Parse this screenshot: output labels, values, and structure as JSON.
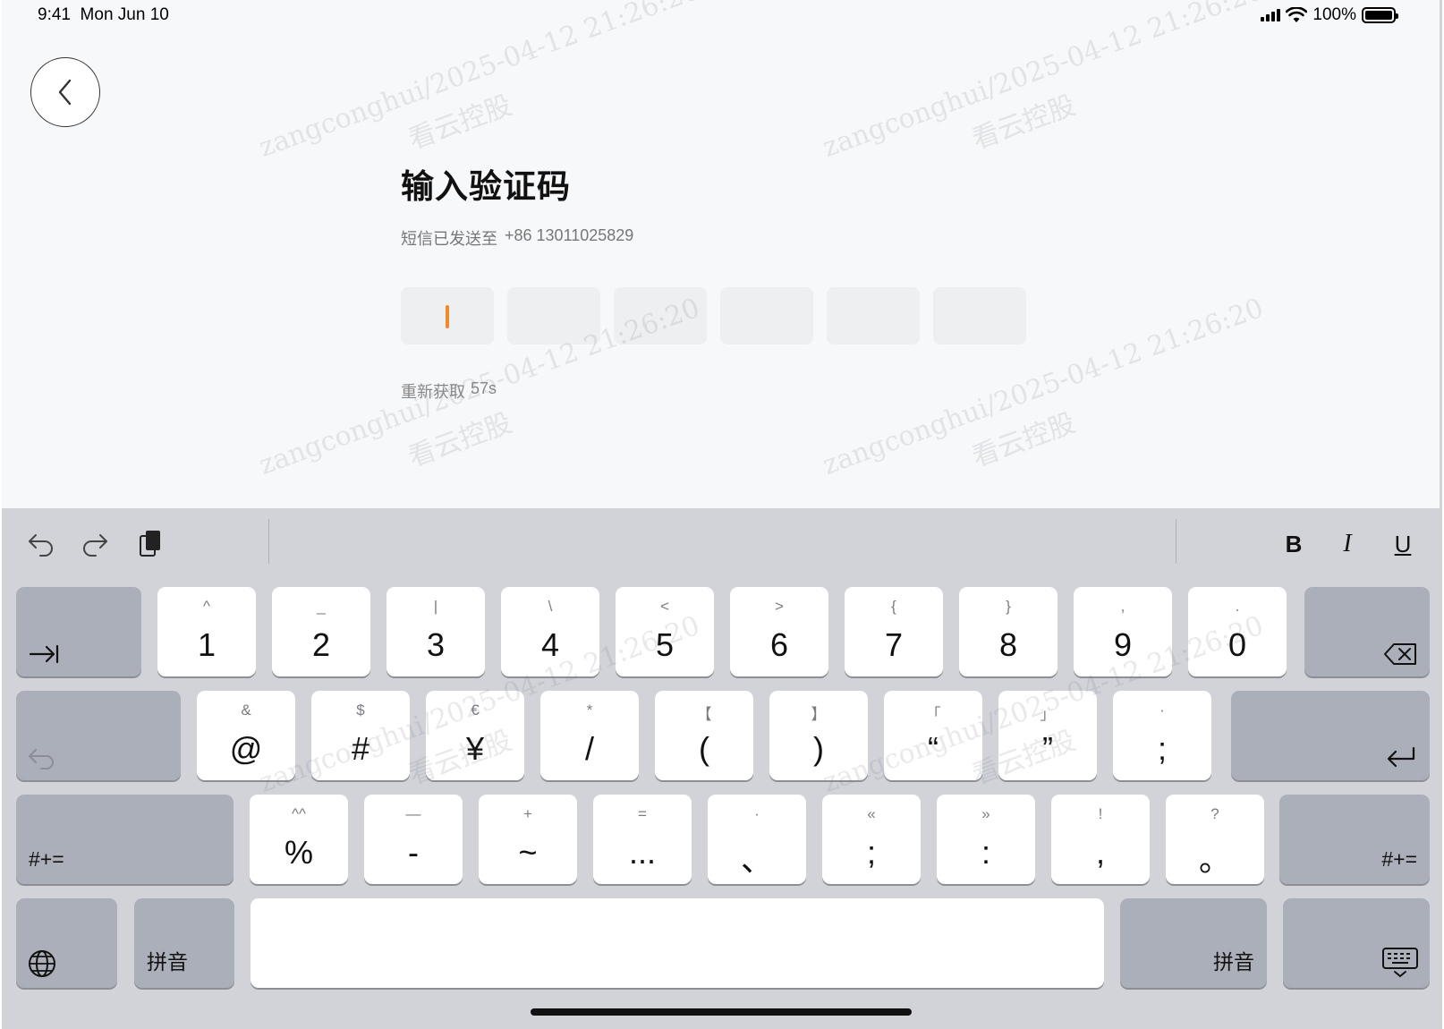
{
  "status_bar": {
    "time": "9:41",
    "date": "Mon Jun 10",
    "battery": "100%"
  },
  "page": {
    "title": "输入验证码",
    "sent_prefix": "短信已发送至",
    "phone": "+86 13011025829",
    "code_length": 6,
    "resend_label": "重新获取",
    "countdown": "57s"
  },
  "watermark": {
    "line": "zangconghui/2025-04-12 21:26:20",
    "company": "看云控股"
  },
  "colors": {
    "caret": "#f08a2c",
    "background": "#f7f8fa",
    "keyboard": "#d1d3d9"
  },
  "keyboard": {
    "toolbar": {
      "undo": "undo-icon",
      "redo": "redo-icon",
      "paste": "clipboard-icon",
      "bold": "B",
      "italic": "I",
      "underline": "U"
    },
    "row1": [
      {
        "sym": "^",
        "main": "1"
      },
      {
        "sym": "_",
        "main": "2"
      },
      {
        "sym": "|",
        "main": "3"
      },
      {
        "sym": "\\",
        "main": "4"
      },
      {
        "sym": "<",
        "main": "5"
      },
      {
        "sym": ">",
        "main": "6"
      },
      {
        "sym": "{",
        "main": "7"
      },
      {
        "sym": "}",
        "main": "8"
      },
      {
        "sym": ",",
        "main": "9"
      },
      {
        "sym": ".",
        "main": "0"
      }
    ],
    "row2": [
      {
        "sym": "&",
        "main": "@"
      },
      {
        "sym": "$",
        "main": "#"
      },
      {
        "sym": "€",
        "main": "¥"
      },
      {
        "sym": "*",
        "main": "/"
      },
      {
        "sym": "【",
        "main": "("
      },
      {
        "sym": "】",
        "main": ")"
      },
      {
        "sym": "「",
        "main": "“"
      },
      {
        "sym": "」",
        "main": "”"
      },
      {
        "sym": "·",
        "main": ";"
      }
    ],
    "row3": [
      {
        "sym": "^^",
        "main": "%"
      },
      {
        "sym": "—",
        "main": "-"
      },
      {
        "sym": "+",
        "main": "~"
      },
      {
        "sym": "=",
        "main": "..."
      },
      {
        "sym": "·",
        "main": "、"
      },
      {
        "sym": "«",
        "main": ";"
      },
      {
        "sym": "»",
        "main": ":"
      },
      {
        "sym": "!",
        "main": ","
      },
      {
        "sym": "?",
        "main": "。"
      }
    ],
    "shift_label": "#+=",
    "pinyin_label": "拼音"
  }
}
